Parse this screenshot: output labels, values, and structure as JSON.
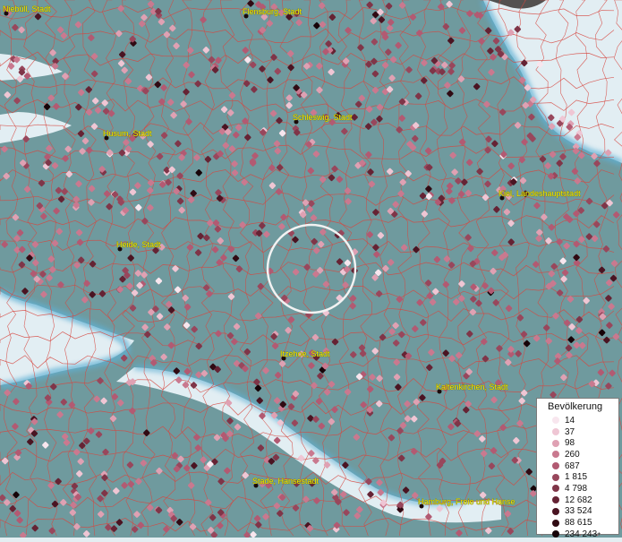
{
  "map": {
    "colors": {
      "land": "#6f9a9e",
      "water": "#d9ecf3",
      "shallow": "#5fb0d4",
      "border": "#d6463f",
      "label": "#f2e400"
    },
    "cities": [
      {
        "name": "Niebüll, Stadt"
      },
      {
        "name": "Flensburg, Stadt"
      },
      {
        "name": "Husum, Stadt"
      },
      {
        "name": "Schleswig, Stadt"
      },
      {
        "name": "Kiel, Landeshauptstadt"
      },
      {
        "name": "Heide, Stadt"
      },
      {
        "name": "Itzehoe, Stadt"
      },
      {
        "name": "Kaltenkirchen, Stadt"
      },
      {
        "name": "Stade, Hansestadt"
      },
      {
        "name": "Hamburg, Freie und Hanse"
      }
    ]
  },
  "legend": {
    "title": "Bevölkerung",
    "items": [
      {
        "label": "14",
        "color": "#f8e6ee"
      },
      {
        "label": "37",
        "color": "#efc6d4"
      },
      {
        "label": "98",
        "color": "#dfa1b3"
      },
      {
        "label": "260",
        "color": "#c9798f"
      },
      {
        "label": "687",
        "color": "#b25a72"
      },
      {
        "label": "1 815",
        "color": "#98475c"
      },
      {
        "label": "4 798",
        "color": "#7f3548"
      },
      {
        "label": "12 682",
        "color": "#652334"
      },
      {
        "label": "33 524",
        "color": "#4a1422"
      },
      {
        "label": "88 615",
        "color": "#300a13"
      },
      {
        "label": "234 243",
        "color": "#160308",
        "suffix": "+"
      }
    ]
  }
}
